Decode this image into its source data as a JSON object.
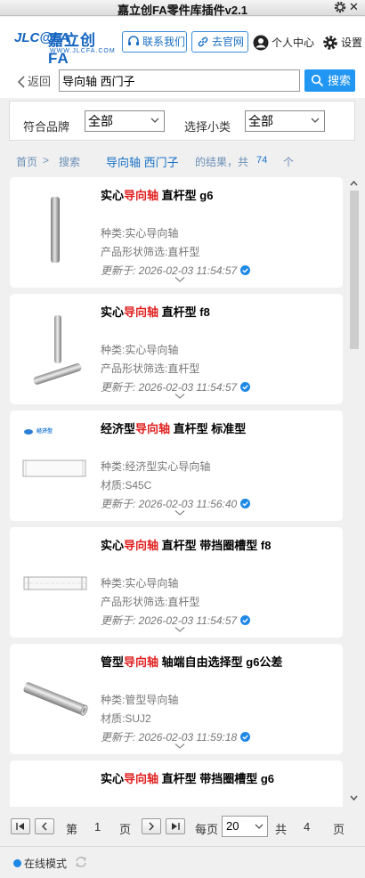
{
  "window": {
    "title": "嘉立创FA零件库插件v2.1"
  },
  "header": {
    "logo_mark": "JLC@FA",
    "logo_cn": "嘉立创FA",
    "logo_url": "WWW.JLCFA.COM",
    "contact_label": "联系我们",
    "site_label": "去官网",
    "user_label": "个人中心",
    "settings_label": "设置"
  },
  "search": {
    "back_label": "返回",
    "query": "导向轴 西门子",
    "button_label": "搜索"
  },
  "filters": {
    "brand_label": "符合品牌",
    "brand_value": "全部",
    "subcat_label": "选择小类",
    "subcat_value": "全部"
  },
  "breadcrumb": {
    "home": "首页",
    "sep": ">",
    "search": "搜索",
    "keyword": "导向轴  西门子",
    "result_prefix": "的结果，共",
    "count": "74",
    "unit": "个"
  },
  "results": [
    {
      "prefix": "实心",
      "highlight": "导向轴",
      "suffix": " 直杆型  g6",
      "line1": "种类:实心导向轴",
      "line2": "产品形状筛选:直杆型",
      "updated": "更新于:  2026-02-03 11:54:57",
      "thumb": "solid-rod"
    },
    {
      "prefix": "实心",
      "highlight": "导向轴",
      "suffix": " 直杆型 f8",
      "line1": "种类:实心导向轴",
      "line2": "产品形状筛选:直杆型",
      "updated": "更新于:  2026-02-03 11:54:57",
      "thumb": "two-rods"
    },
    {
      "prefix": "经济型",
      "highlight": "导向轴",
      "suffix": " 直杆型 标准型",
      "line1": "种类:经济型实心导向轴",
      "line2": "材质:S45C",
      "updated": "更新于:  2026-02-03 11:56:40",
      "thumb": "economy-drawing",
      "thumb_logo": "经济型"
    },
    {
      "prefix": "实心",
      "highlight": "导向轴",
      "suffix": " 直杆型 带挡圈槽型 f8",
      "line1": "种类:实心导向轴",
      "line2": "产品形状筛选:直杆型",
      "updated": "更新于:  2026-02-03 11:54:57",
      "thumb": "grooved-rod"
    },
    {
      "prefix": "管型",
      "highlight": "导向轴",
      "suffix": " 轴端自由选择型 g6公差",
      "line1": "种类:管型导向轴",
      "line2": "材质:SUJ2",
      "updated": "更新于:  2026-02-03 11:59:18",
      "thumb": "tube-rod"
    },
    {
      "prefix": "实心",
      "highlight": "导向轴",
      "suffix": " 直杆型 带挡圈槽型 g6",
      "line1": "",
      "line2": "",
      "updated": "",
      "thumb": "none"
    }
  ],
  "pager": {
    "prefix": "第",
    "page": "1",
    "page_unit": "页",
    "per_page_label": "每页",
    "per_page": "20",
    "total_prefix": "共",
    "total_pages": "4",
    "total_unit": "页"
  },
  "status": {
    "mode": "在线模式"
  },
  "colors": {
    "accent": "#2196f3",
    "highlight": "#e02020",
    "link": "#1a73c8"
  }
}
